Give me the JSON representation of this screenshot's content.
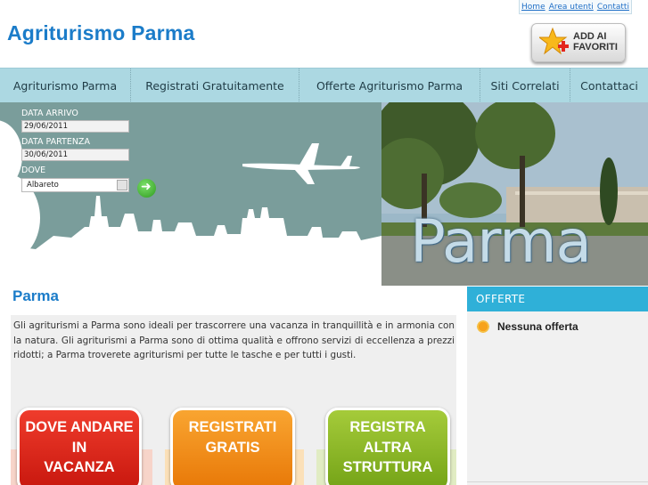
{
  "top_links": {
    "home": "Home",
    "area_utenti": "Area utenti",
    "contatti": "Contatti"
  },
  "site_title": "Agriturismo Parma",
  "favorites": {
    "line1": "ADD AI",
    "line2": "FAVORITI"
  },
  "nav": [
    {
      "label": "Agriturismo Parma"
    },
    {
      "label": "Registrati Gratuitamente"
    },
    {
      "label": "Offerte Agriturismo Parma"
    },
    {
      "label": "Siti Correlati"
    },
    {
      "label": "Contattaci"
    }
  ],
  "search": {
    "arrival_label": "DATA ARRIVO",
    "arrival_value": "29/06/2011",
    "departure_label": "DATA PARTENZA",
    "departure_value": "30/06/2011",
    "where_label": "DOVE",
    "where_value": "Albareto"
  },
  "photo_caption": "Parma",
  "main": {
    "heading": "Parma",
    "text": "Gli agriturismi a Parma sono ideali per trascorrere una vacanza in tranquillità e in armonia con la natura. Gli agriturismi a Parma sono di ottima qualità e offrono servizi di eccellenza a prezzi ridotti; a Parma troverete agriturismi per tutte le tasche e per tutti i gusti."
  },
  "cta": [
    {
      "lines": [
        "DOVE ANDARE",
        "IN",
        "VACANZA"
      ],
      "color": "#e2261b"
    },
    {
      "lines": [
        "REGISTRATI",
        "GRATIS"
      ],
      "color": "#f2890f"
    },
    {
      "lines": [
        "REGISTRA",
        "ALTRA",
        "STRUTTURA"
      ],
      "color": "#8ab825"
    }
  ],
  "sidebar": {
    "heading": "OFFERTE",
    "offer": "Nessuna offerta"
  },
  "colors": {
    "brand": "#1b7cc9",
    "nav_bg": "#acd8e2",
    "sidebar_head": "#2fb0d8"
  }
}
